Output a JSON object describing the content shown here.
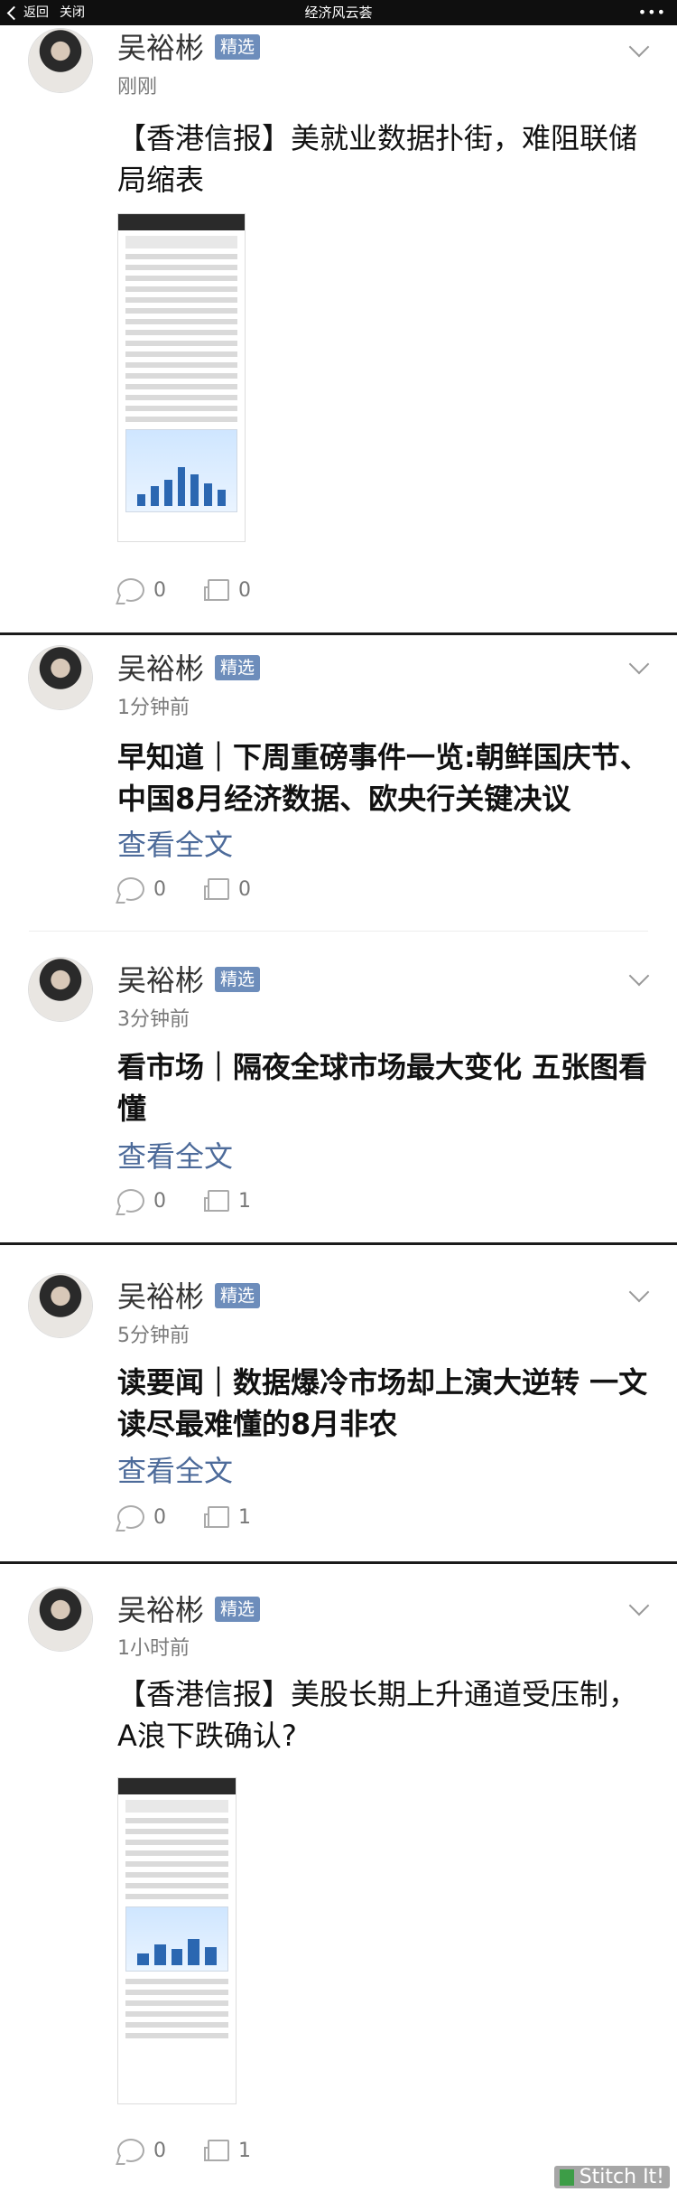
{
  "topbar": {
    "back_label": "返回",
    "close_label": "关闭",
    "title": "经济风云荟",
    "more": "•••"
  },
  "posts": [
    {
      "author": "吴裕彬",
      "badge": "精选",
      "time": "刚刚",
      "title": "【香港信报】美就业数据扑街，难阻联储局缩表",
      "comments": "0",
      "likes": "0"
    },
    {
      "author": "吴裕彬",
      "badge": "精选",
      "time": "1分钟前",
      "title": "早知道｜下周重磅事件一览:朝鲜国庆节、中国8月经济数据、欧央行关键决议",
      "read_more": "查看全文",
      "comments": "0",
      "likes": "0"
    },
    {
      "author": "吴裕彬",
      "badge": "精选",
      "time": "3分钟前",
      "title": "看市场｜隔夜全球市场最大变化 五张图看懂",
      "read_more": "查看全文",
      "comments": "0",
      "likes": "1"
    },
    {
      "author": "吴裕彬",
      "badge": "精选",
      "time": "5分钟前",
      "title": "读要闻｜数据爆冷市场却上演大逆转 一文读尽最难懂的8月非农",
      "read_more": "查看全文",
      "comments": "0",
      "likes": "1"
    },
    {
      "author": "吴裕彬",
      "badge": "精选",
      "time": "1小时前",
      "title": "【香港信报】美股长期上升通道受压制，A浪下跌确认?",
      "comments": "0",
      "likes": "1"
    }
  ],
  "watermark": "Stitch It!"
}
